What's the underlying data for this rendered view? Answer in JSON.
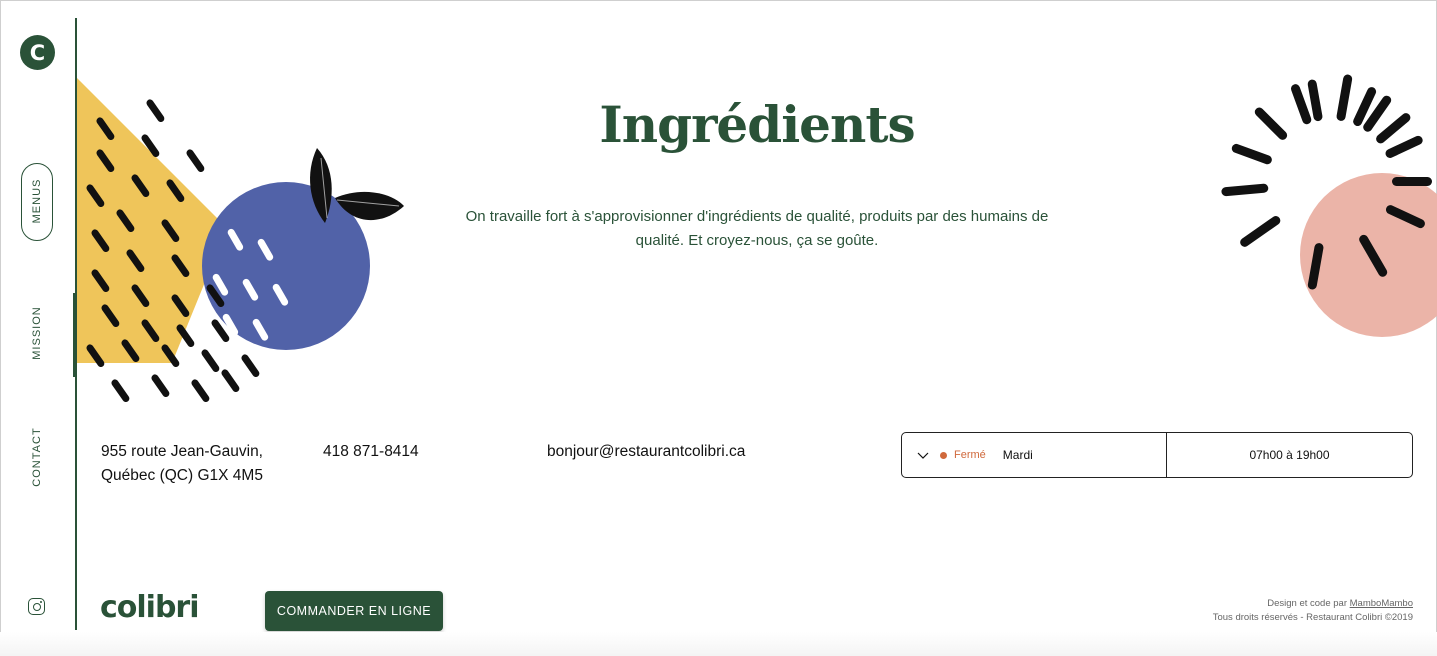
{
  "sidebar": {
    "logo_letter": "C",
    "nav": [
      {
        "label": "MENUS"
      },
      {
        "label": "MISSION"
      },
      {
        "label": "CONTACT"
      }
    ],
    "social_icon": "instagram-icon"
  },
  "hero": {
    "title": "Ingrédients",
    "description": "On travaille fort à s'approvisionner d'ingrédients de qualité, produits par des humains de qualité. Et croyez-nous, ça se goûte."
  },
  "contact": {
    "address_line1": "955 route Jean-Gauvin,",
    "address_line2": "Québec (QC) G1X 4M5",
    "phone": "418 871-8414",
    "email": "bonjour@restaurantcolibri.ca"
  },
  "hours": {
    "status": "Fermé",
    "day": "Mardi",
    "time": "07h00 à 19h00"
  },
  "footer": {
    "brand": "colibri",
    "order_button": "COMMANDER EN LIGNE",
    "credit_prefix": "Design et code par",
    "credit_link": "MamboMambo",
    "copyright": "Tous droits réservés - Restaurant Colibri ©2019"
  },
  "colors": {
    "brand_green": "#2a5238",
    "status_orange": "#d0693c",
    "yellow": "#efc55a",
    "blue": "#5162a8",
    "pink": "#ebb4a8"
  }
}
